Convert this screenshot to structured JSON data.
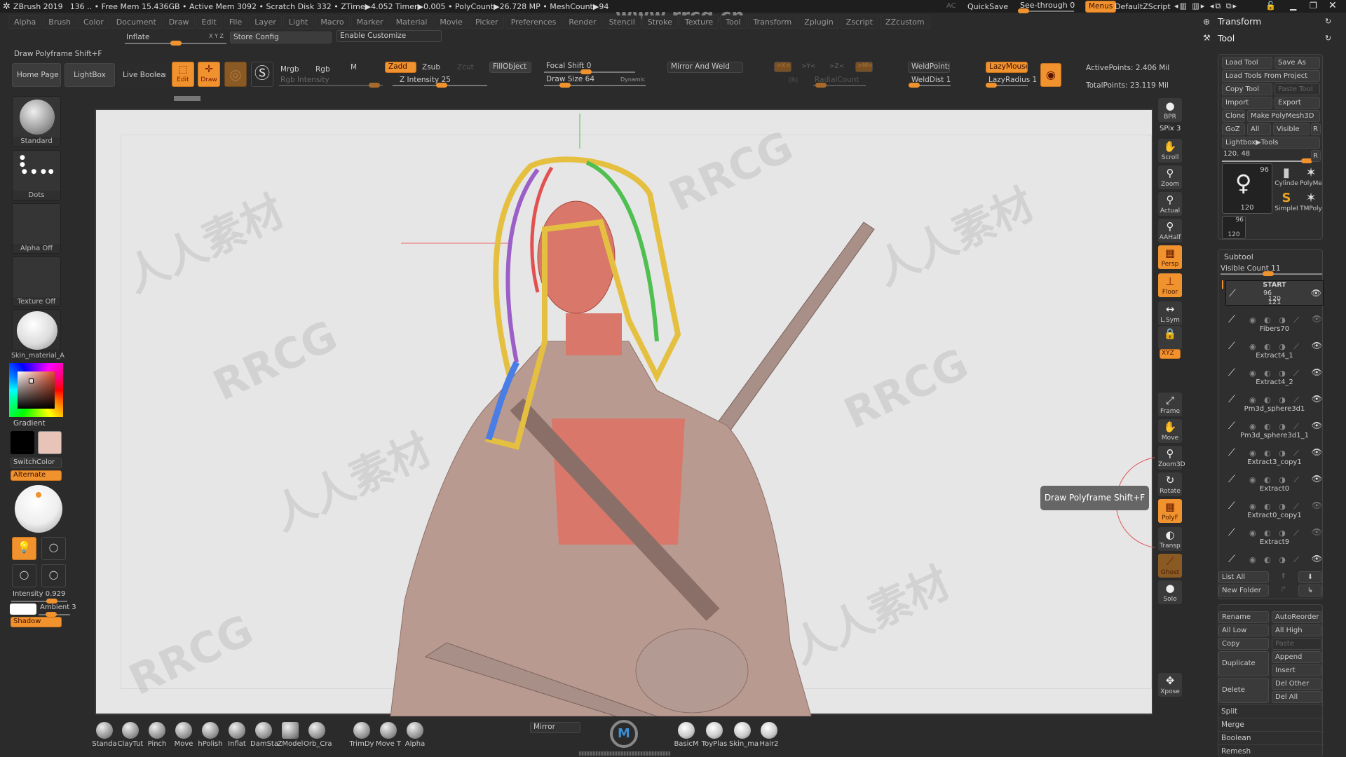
{
  "titlebar": {
    "app": "ZBrush 2019",
    "stats": "136   .. • Free Mem 15.436GB • Active Mem 3092 • Scratch Disk 332 •  ZTime▶4.052 Timer▶0.005 • PolyCount▶26.728 MP  • MeshCount▶94",
    "ac": "AC",
    "quicksave": "QuickSave",
    "see_through": "See-through  0",
    "see_through_value": 0,
    "menus": "Menus",
    "default_zscript": "DefaultZScript",
    "watermark_url": "www.rrcg.cn"
  },
  "menubar": [
    "Alpha",
    "Brush",
    "Color",
    "Document",
    "Draw",
    "Edit",
    "File",
    "Layer",
    "Light",
    "Macro",
    "Marker",
    "Material",
    "Movie",
    "Picker",
    "Preferences",
    "Render",
    "Stencil",
    "Stroke",
    "Texture",
    "Tool",
    "Transform",
    "Zplugin",
    "Zscript",
    "ZZcustom"
  ],
  "custom_bar": {
    "inflate": "Inflate",
    "xyz": "X Y Z",
    "store_config": "Store Config",
    "enable_customize": "Enable Customize"
  },
  "status_hint": "Draw Polyframe Shift+F",
  "toolbar": {
    "home_page": "Home Page",
    "lightbox": "LightBox",
    "live_boolean": "Live Boolean",
    "edit": "Edit",
    "draw": "Draw",
    "mrgb": "Mrgb",
    "rgb": "Rgb",
    "m": "M",
    "rgb_intensity": "Rgb Intensity",
    "zadd": "Zadd",
    "zsub": "Zsub",
    "zcut": "Zcut",
    "z_intensity": "Z Intensity 25",
    "fill_object": "FillObject",
    "focal_shift": "Focal Shift 0",
    "draw_size": "Draw Size 64",
    "dynamic": "Dynamic",
    "mirror_and_weld": "Mirror And Weld",
    "x": ">X<",
    "y": ">Y<",
    "z": ">Z<",
    "m_sym": ">M<",
    "r": "(R)",
    "radial_count": "RadialCount",
    "weld_points": "WeldPoints",
    "weld_dist": "WeldDist 1",
    "lazy_mouse": "LazyMouse",
    "lazy_radius": "LazyRadius 1",
    "active_points": "ActivePoints: 2.406 Mil",
    "total_points": "TotalPoints: 23.119 Mil"
  },
  "left_tray": {
    "brush": "Standard",
    "stroke": "Dots",
    "alpha": "Alpha Off",
    "texture": "Texture Off",
    "material": "Skin_material_A",
    "gradient": "Gradient",
    "switch_color": "SwitchColor",
    "alternate": "Alternate",
    "intensity": "Intensity 0.929",
    "ambient": "Ambient 3",
    "shadow": "Shadow",
    "main_color": "#e7c3b8",
    "secondary_color": "#000000"
  },
  "right_shelf": [
    {
      "label": "BPR",
      "icon": "●"
    },
    {
      "label": "SPix 3",
      "icon": ""
    },
    {
      "label": "Scroll",
      "icon": "✋"
    },
    {
      "label": "Zoom",
      "icon": "⚲"
    },
    {
      "label": "Actual",
      "icon": "⚲"
    },
    {
      "label": "AAHalf",
      "icon": "⚲"
    },
    {
      "label": "Persp",
      "icon": "▦"
    },
    {
      "label": "Floor",
      "icon": "⊥"
    },
    {
      "label": "L.Sym",
      "icon": "↔"
    },
    {
      "label": "",
      "icon": "🔒"
    },
    {
      "label": "XYZ",
      "icon": ""
    },
    {
      "label": "Frame",
      "icon": "⤢"
    },
    {
      "label": "Move",
      "icon": "✋"
    },
    {
      "label": "Zoom3D",
      "icon": "⚲"
    },
    {
      "label": "Rotate",
      "icon": "↻"
    },
    {
      "label": "PolyF",
      "icon": "▦"
    },
    {
      "label": "Transp",
      "icon": "◐"
    },
    {
      "label": "Ghost",
      "icon": "⟋"
    },
    {
      "label": "Solo",
      "icon": "●"
    },
    {
      "label": "Xpose",
      "icon": "✥"
    }
  ],
  "tooltip": "Draw Polyframe  Shift+F",
  "tool_palette": {
    "header_transform": "Transform",
    "header_tool": "Tool",
    "buttons": {
      "load_tool": "Load Tool",
      "save_as": "Save As",
      "load_tools_from_project": "Load Tools From Project",
      "copy_tool": "Copy Tool",
      "paste_tool": "Paste Tool",
      "import": "Import",
      "export": "Export",
      "clone": "Clone",
      "make_polymesh": "Make PolyMesh3D",
      "goz": "GoZ",
      "all": "All",
      "visible": "Visible",
      "r": "R",
      "lightbox_tools": "Lightbox▶Tools",
      "slider_value": "120. 48"
    },
    "thumbs": [
      {
        "name": "current",
        "top": "96",
        "bottom": "120"
      },
      {
        "name": "Cylinde"
      },
      {
        "name": "PolyMe"
      },
      {
        "name": "SimpleI"
      },
      {
        "name": "TMPoly"
      },
      {
        "name": "small",
        "top": "96",
        "bottom": "120"
      }
    ]
  },
  "subtool": {
    "title": "Subtool",
    "visible_count": "Visible Count 11",
    "items": [
      {
        "name": "START",
        "sub": "96",
        "sub2": "120"
      },
      {
        "name": "121"
      },
      {
        "name": "Fibers70"
      },
      {
        "name": "Extract4_1"
      },
      {
        "name": "Extract4_2"
      },
      {
        "name": "Pm3d_sphere3d1"
      },
      {
        "name": "Pm3d_sphere3d1_1"
      },
      {
        "name": "Extract3_copy1"
      },
      {
        "name": "Extract0"
      },
      {
        "name": "Extract0_copy1"
      },
      {
        "name": "Extract9"
      }
    ],
    "list_all": "List All",
    "new_folder": "New Folder",
    "rename": "Rename",
    "auto_reorder": "AutoReorder",
    "all_low": "All Low",
    "all_high": "All High",
    "copy": "Copy",
    "paste": "Paste",
    "duplicate": "Duplicate",
    "append": "Append",
    "insert": "Insert",
    "delete": "Delete",
    "del_other": "Del Other",
    "del_all": "Del All",
    "sections": [
      "Split",
      "Merge",
      "Boolean",
      "Remesh"
    ]
  },
  "bottom_shelf": {
    "brushes": [
      "Standa",
      "ClayTut",
      "Pinch",
      "Move",
      "hPolish",
      "Inflat",
      "DamSta",
      "ZModel",
      "Orb_Cra",
      "TrimDy",
      "Move T",
      "Alpha"
    ],
    "mirror": "Mirror",
    "materials": [
      "BasicM",
      "ToyPlas",
      "Skin_ma",
      "Hair2"
    ]
  },
  "colors": {
    "accent": "#f0922e",
    "canvas": "#e6e6e6",
    "ui_bg": "#2b2b2b"
  }
}
